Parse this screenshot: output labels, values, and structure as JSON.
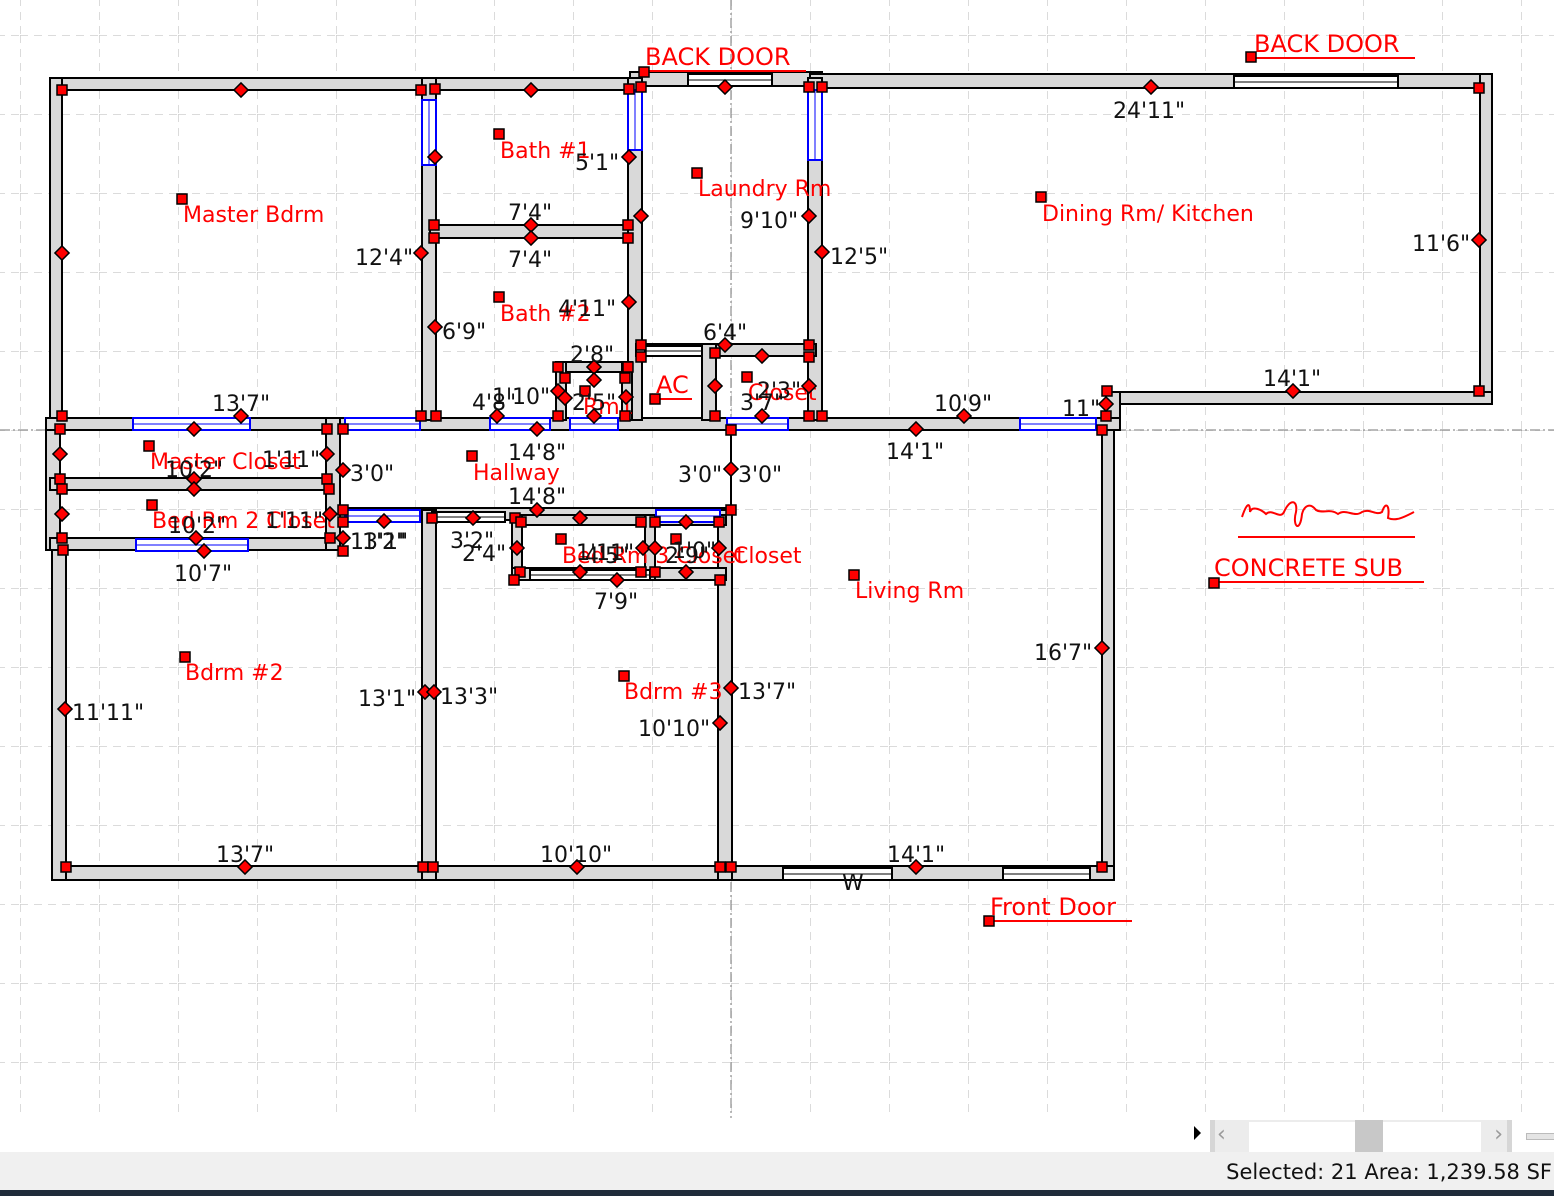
{
  "rooms": {
    "master_bdrm": "Master Bdrm",
    "bath1": "Bath #1",
    "laundry": "Laundry Rm",
    "dining_kitchen": "Dining Rm/ Kitchen",
    "bath2": "Bath #2",
    "rm1": "Rm1",
    "closet_upper": "Closet",
    "master_closet": "Master Closet",
    "hallway": "Hallway",
    "bedrm2_closet": "Bed Rm 2 Closet",
    "bedrm3_closet": "Bed Rm 3 Closet",
    "closet_lower": "Closet",
    "living": "Living Rm",
    "bdrm2": "Bdrm #2",
    "bdrm3": "Bdrm #3"
  },
  "annotations": {
    "back_door_1": "BACK DOOR",
    "back_door_2": "BACK DOOR",
    "ac": "AC",
    "concrete_sub": "CONCRETE SUB",
    "front_door": "Front Door",
    "signature": "Ronald J Leonard"
  },
  "dimensions": [
    "24'11\"",
    "5'1\"",
    "7'4\"",
    "9'10\"",
    "12'5\"",
    "11'6\"",
    "12'4\"",
    "7'4\"",
    "4'11\"",
    "6'9\"",
    "6'4\"",
    "2'8\"",
    "14'1\"",
    "13'7\"",
    "4'8\"",
    "1'10\"",
    "2'5\"",
    "2'3\"",
    "3'7\"",
    "10'9\"",
    "11\"",
    "14'8\"",
    "14'1\"",
    "1'11\"",
    "10'2\"",
    "3'0\"",
    "3'0\"",
    "3'0\"",
    "14'8\"",
    "1'11\"",
    "10'2\"",
    "13'1\"",
    "1'2\"",
    "3'2\"",
    "2'4\"",
    "4'5\"",
    "1'11\"",
    "2'9\"",
    "1'0\"",
    "10'7\"",
    "7'9\"",
    "16'7\"",
    "13'1\"",
    "13'3\"",
    "11'11\"",
    "13'7\"",
    "10'10\"",
    "13'7\"",
    "10'10\"",
    "14'1\"",
    "W"
  ],
  "status": {
    "text": "Selected: 21 Area: 1,239.58 SF"
  },
  "colors": {
    "wall": "#d9d9d9",
    "handle": "#ff0000",
    "window": "#0000ff",
    "label": "#ff0000"
  }
}
